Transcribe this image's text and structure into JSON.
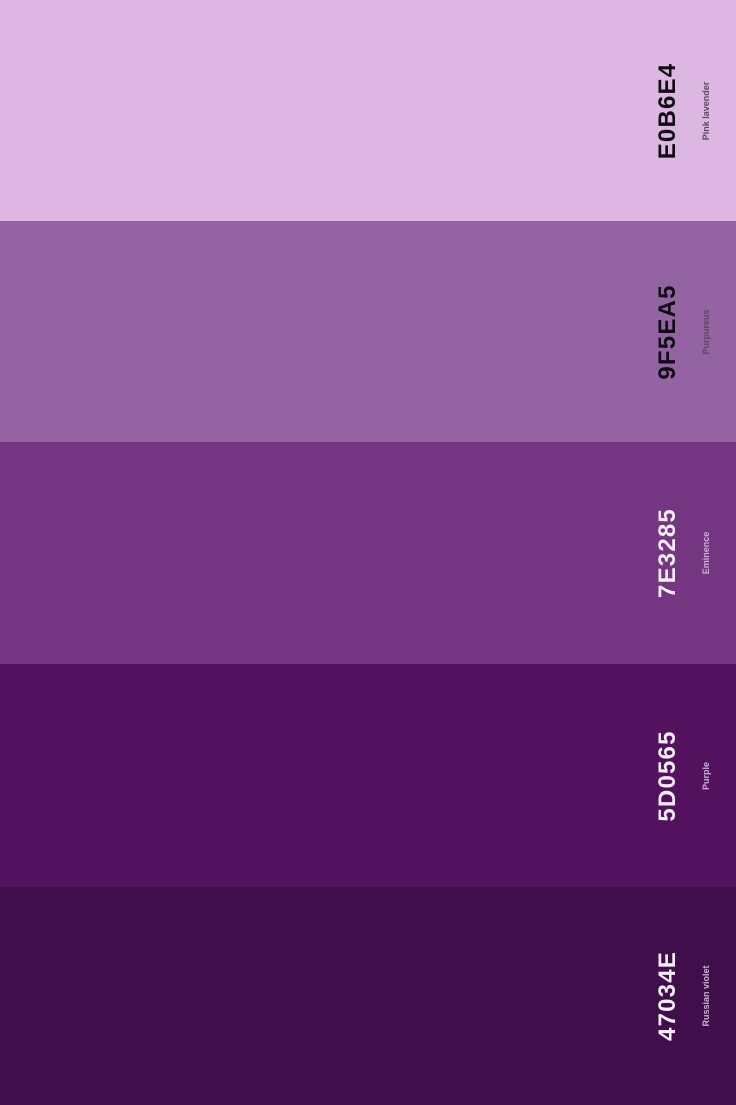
{
  "swatches": [
    {
      "hex": "E0B6E4",
      "name": "Pink lavender",
      "color": "#DBB7E2"
    },
    {
      "hex": "9F5EA5",
      "name": "Purpureus",
      "color": "#9463A1"
    },
    {
      "hex": "7E3285",
      "name": "Eminence",
      "color": "#743681"
    },
    {
      "hex": "5D0565",
      "name": "Purple",
      "color": "#52125E"
    },
    {
      "hex": "47034E",
      "name": "Russian violet",
      "color": "#410E4C"
    }
  ]
}
